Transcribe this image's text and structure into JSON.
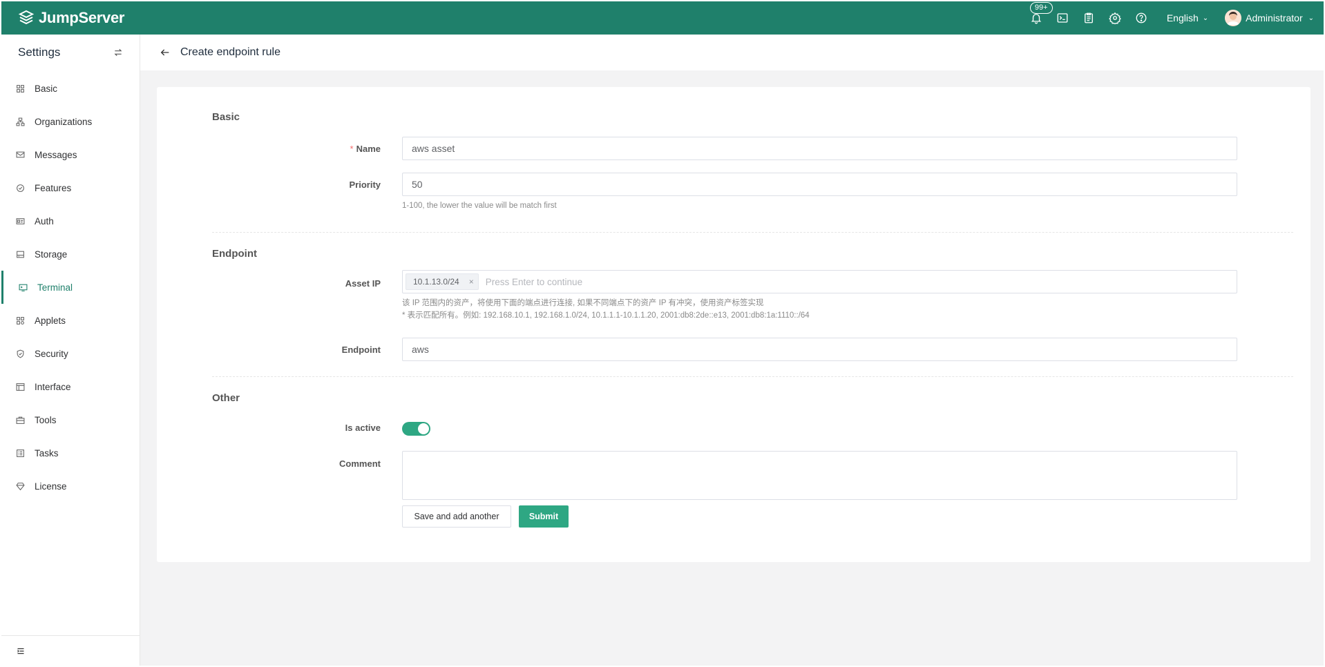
{
  "header": {
    "logo_text": "JumpServer",
    "notification_badge": "99+",
    "language": "English",
    "user_name": "Administrator"
  },
  "sidebar": {
    "title": "Settings",
    "items": [
      {
        "label": "Basic",
        "icon": "grid-icon"
      },
      {
        "label": "Organizations",
        "icon": "org-tree-icon"
      },
      {
        "label": "Messages",
        "icon": "message-icon"
      },
      {
        "label": "Features",
        "icon": "feature-icon"
      },
      {
        "label": "Auth",
        "icon": "id-card-icon"
      },
      {
        "label": "Storage",
        "icon": "storage-icon"
      },
      {
        "label": "Terminal",
        "icon": "terminal-icon",
        "active": true
      },
      {
        "label": "Applets",
        "icon": "applets-icon"
      },
      {
        "label": "Security",
        "icon": "shield-icon"
      },
      {
        "label": "Interface",
        "icon": "interface-icon"
      },
      {
        "label": "Tools",
        "icon": "toolbox-icon"
      },
      {
        "label": "Tasks",
        "icon": "tasks-icon"
      },
      {
        "label": "License",
        "icon": "license-icon"
      }
    ]
  },
  "page": {
    "title": "Create endpoint rule"
  },
  "form": {
    "sections": {
      "basic": "Basic",
      "endpoint": "Endpoint",
      "other": "Other"
    },
    "name": {
      "label": "Name",
      "required_mark": "*",
      "value": "aws asset"
    },
    "priority": {
      "label": "Priority",
      "value": "50",
      "hint": "1-100, the lower the value will be match first"
    },
    "asset_ip": {
      "label": "Asset IP",
      "tag": "10.1.13.0/24",
      "tag_close": "×",
      "placeholder": "Press Enter to continue",
      "hint1": "该 IP 范围内的资产，将使用下面的端点进行连接, 如果不同端点下的资产 IP 有冲突，使用资产标签实现",
      "hint2": "* 表示匹配所有。例如: 192.168.10.1, 192.168.1.0/24, 10.1.1.1-10.1.1.20, 2001:db8:2de::e13, 2001:db8:1a:1110::/64"
    },
    "endpoint": {
      "label": "Endpoint",
      "value": "aws"
    },
    "is_active": {
      "label": "Is active",
      "value": true
    },
    "comment": {
      "label": "Comment",
      "value": ""
    },
    "buttons": {
      "save_and_add": "Save and add another",
      "submit": "Submit"
    }
  },
  "colors": {
    "brand": "#1f806b",
    "primary_button": "#2ea783"
  }
}
